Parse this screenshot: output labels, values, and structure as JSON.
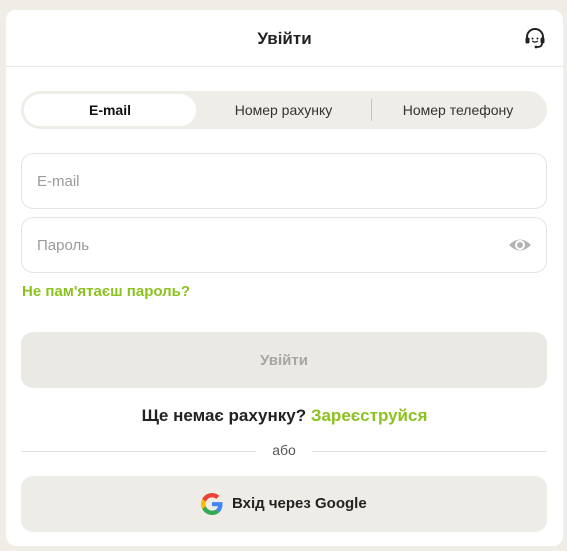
{
  "header": {
    "title": "Увійти",
    "support_icon": "headset-icon"
  },
  "tabs": [
    {
      "label": "E-mail",
      "active": true
    },
    {
      "label": "Номер рахунку",
      "active": false
    },
    {
      "label": "Номер телефону",
      "active": false
    }
  ],
  "form": {
    "email": {
      "placeholder": "E-mail",
      "value": ""
    },
    "password": {
      "placeholder": "Пароль",
      "value": "",
      "toggle_icon": "eye-icon"
    },
    "forgot_label": "Не пам'ятаєш пароль?",
    "submit_label": "Увійти"
  },
  "register": {
    "prompt": "Ще немає рахунку?",
    "link": "Зареєструйся"
  },
  "divider": "або",
  "google": {
    "label": "Вхід через Google",
    "icon": "google-logo-icon"
  },
  "colors": {
    "accent": "#8cc21f",
    "background": "#efede6",
    "disabled_button": "#ebe9e3"
  }
}
